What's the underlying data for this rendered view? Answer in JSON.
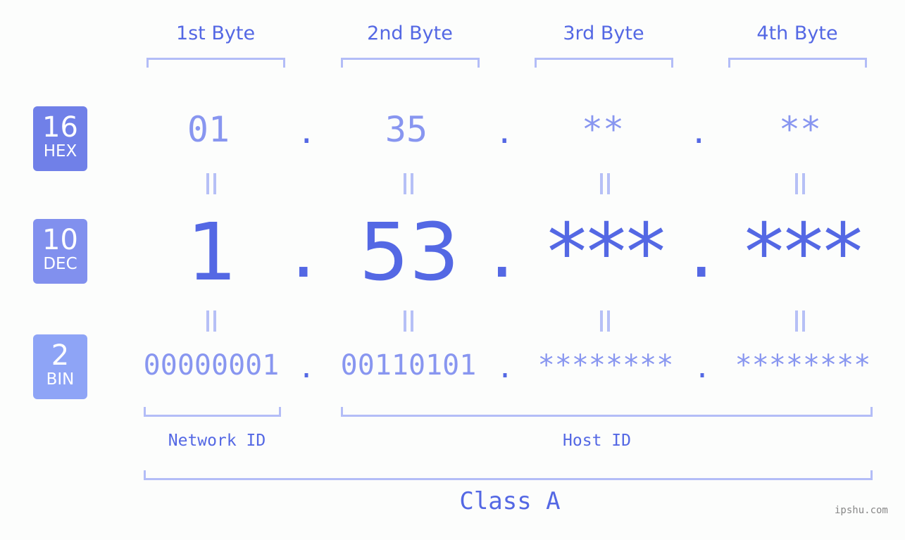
{
  "header": {
    "bytes": [
      "1st Byte",
      "2nd Byte",
      "3rd Byte",
      "4th Byte"
    ]
  },
  "rows": {
    "hex": {
      "base": "16",
      "label": "HEX",
      "octets": [
        "01",
        "35",
        "**",
        "**"
      ],
      "color": "#7080e8"
    },
    "dec": {
      "base": "10",
      "label": "DEC",
      "octets": [
        "1",
        "53",
        "***",
        "***"
      ],
      "color": "#8190ee"
    },
    "bin": {
      "base": "2",
      "label": "BIN",
      "octets": [
        "00000001",
        "00110101",
        "********",
        "********"
      ],
      "color": "#8ea4f6"
    }
  },
  "separator": ".",
  "segments": {
    "network": "Network ID",
    "host": "Host ID",
    "class": "Class A"
  },
  "watermark": "ipshu.com",
  "colors": {
    "accent": "#5468e4",
    "light": "#8896f0",
    "bracket": "#b3bdf7"
  }
}
